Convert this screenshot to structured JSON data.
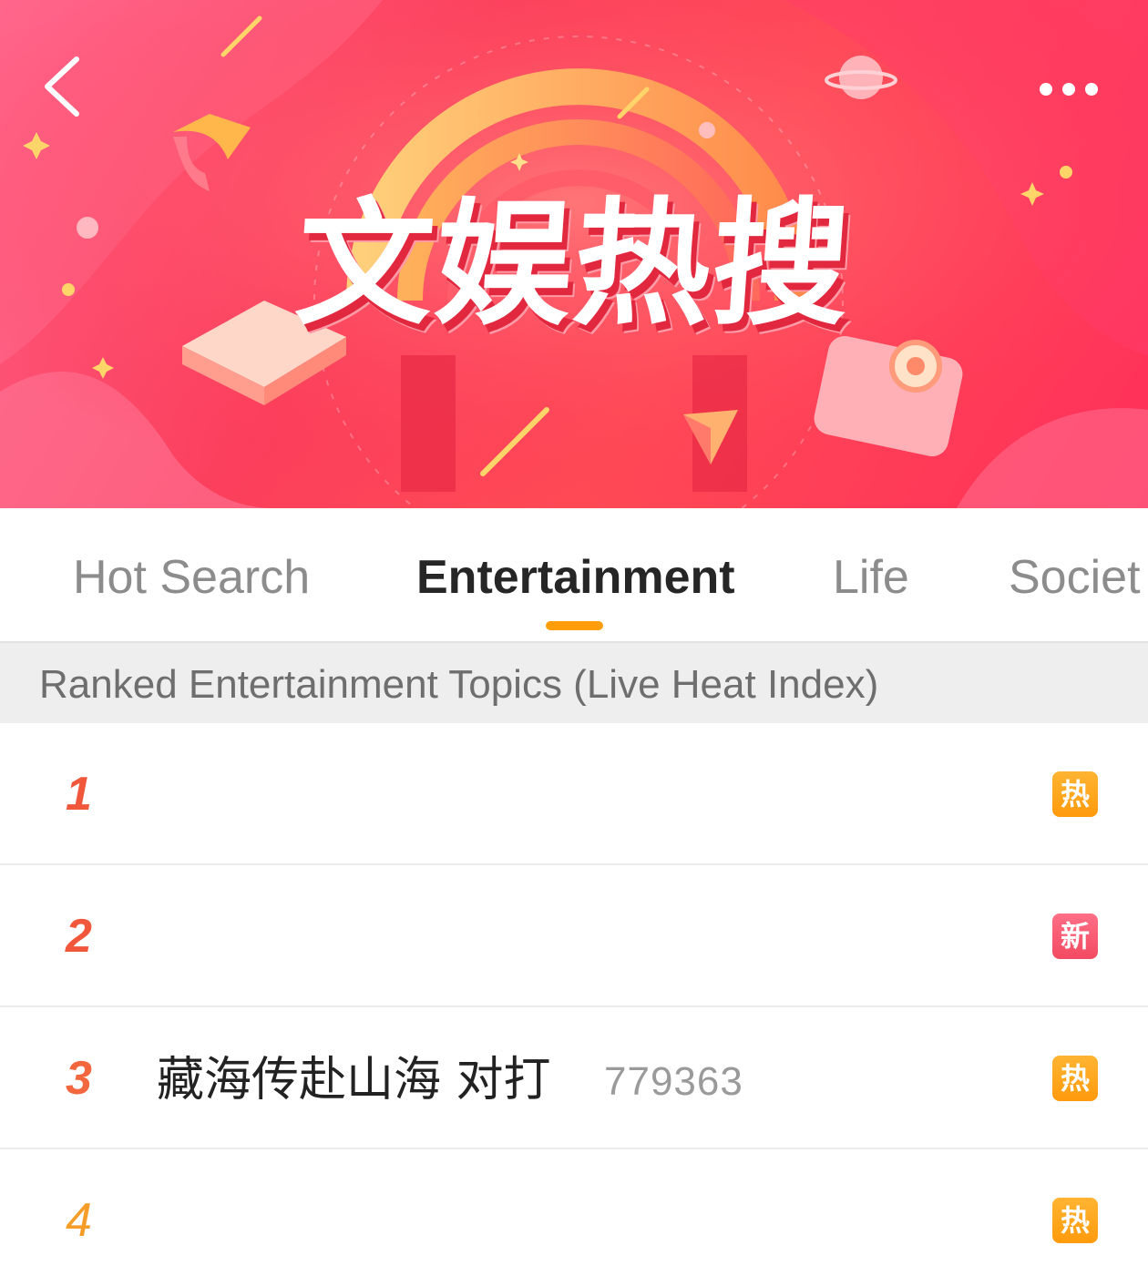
{
  "header": {
    "banner_title": "文娱热搜",
    "back_icon": "chevron-left-icon",
    "more_icon": "more-horizontal-icon",
    "banner_colors": {
      "primary": "#fb3f5c",
      "accent": "#ffb64a"
    }
  },
  "tabs": [
    {
      "label": "Hot Search",
      "active": false
    },
    {
      "label": "Entertainment",
      "active": true
    },
    {
      "label": "Life",
      "active": false
    },
    {
      "label": "Societ",
      "active": false
    }
  ],
  "accent_color": "#ff9e0a",
  "section": {
    "title": "Ranked Entertainment Topics (Live Heat Index)"
  },
  "rows": [
    {
      "rank": "1",
      "topic": "",
      "heat": "",
      "badge": "热",
      "badge_type": "hot"
    },
    {
      "rank": "2",
      "topic": "",
      "heat": "",
      "badge": "新",
      "badge_type": "new"
    },
    {
      "rank": "3",
      "topic": "藏海传赴山海 对打",
      "heat": "779363",
      "badge": "热",
      "badge_type": "hot"
    },
    {
      "rank": "4",
      "topic": "",
      "heat": "",
      "badge": "热",
      "badge_type": "hot"
    }
  ]
}
